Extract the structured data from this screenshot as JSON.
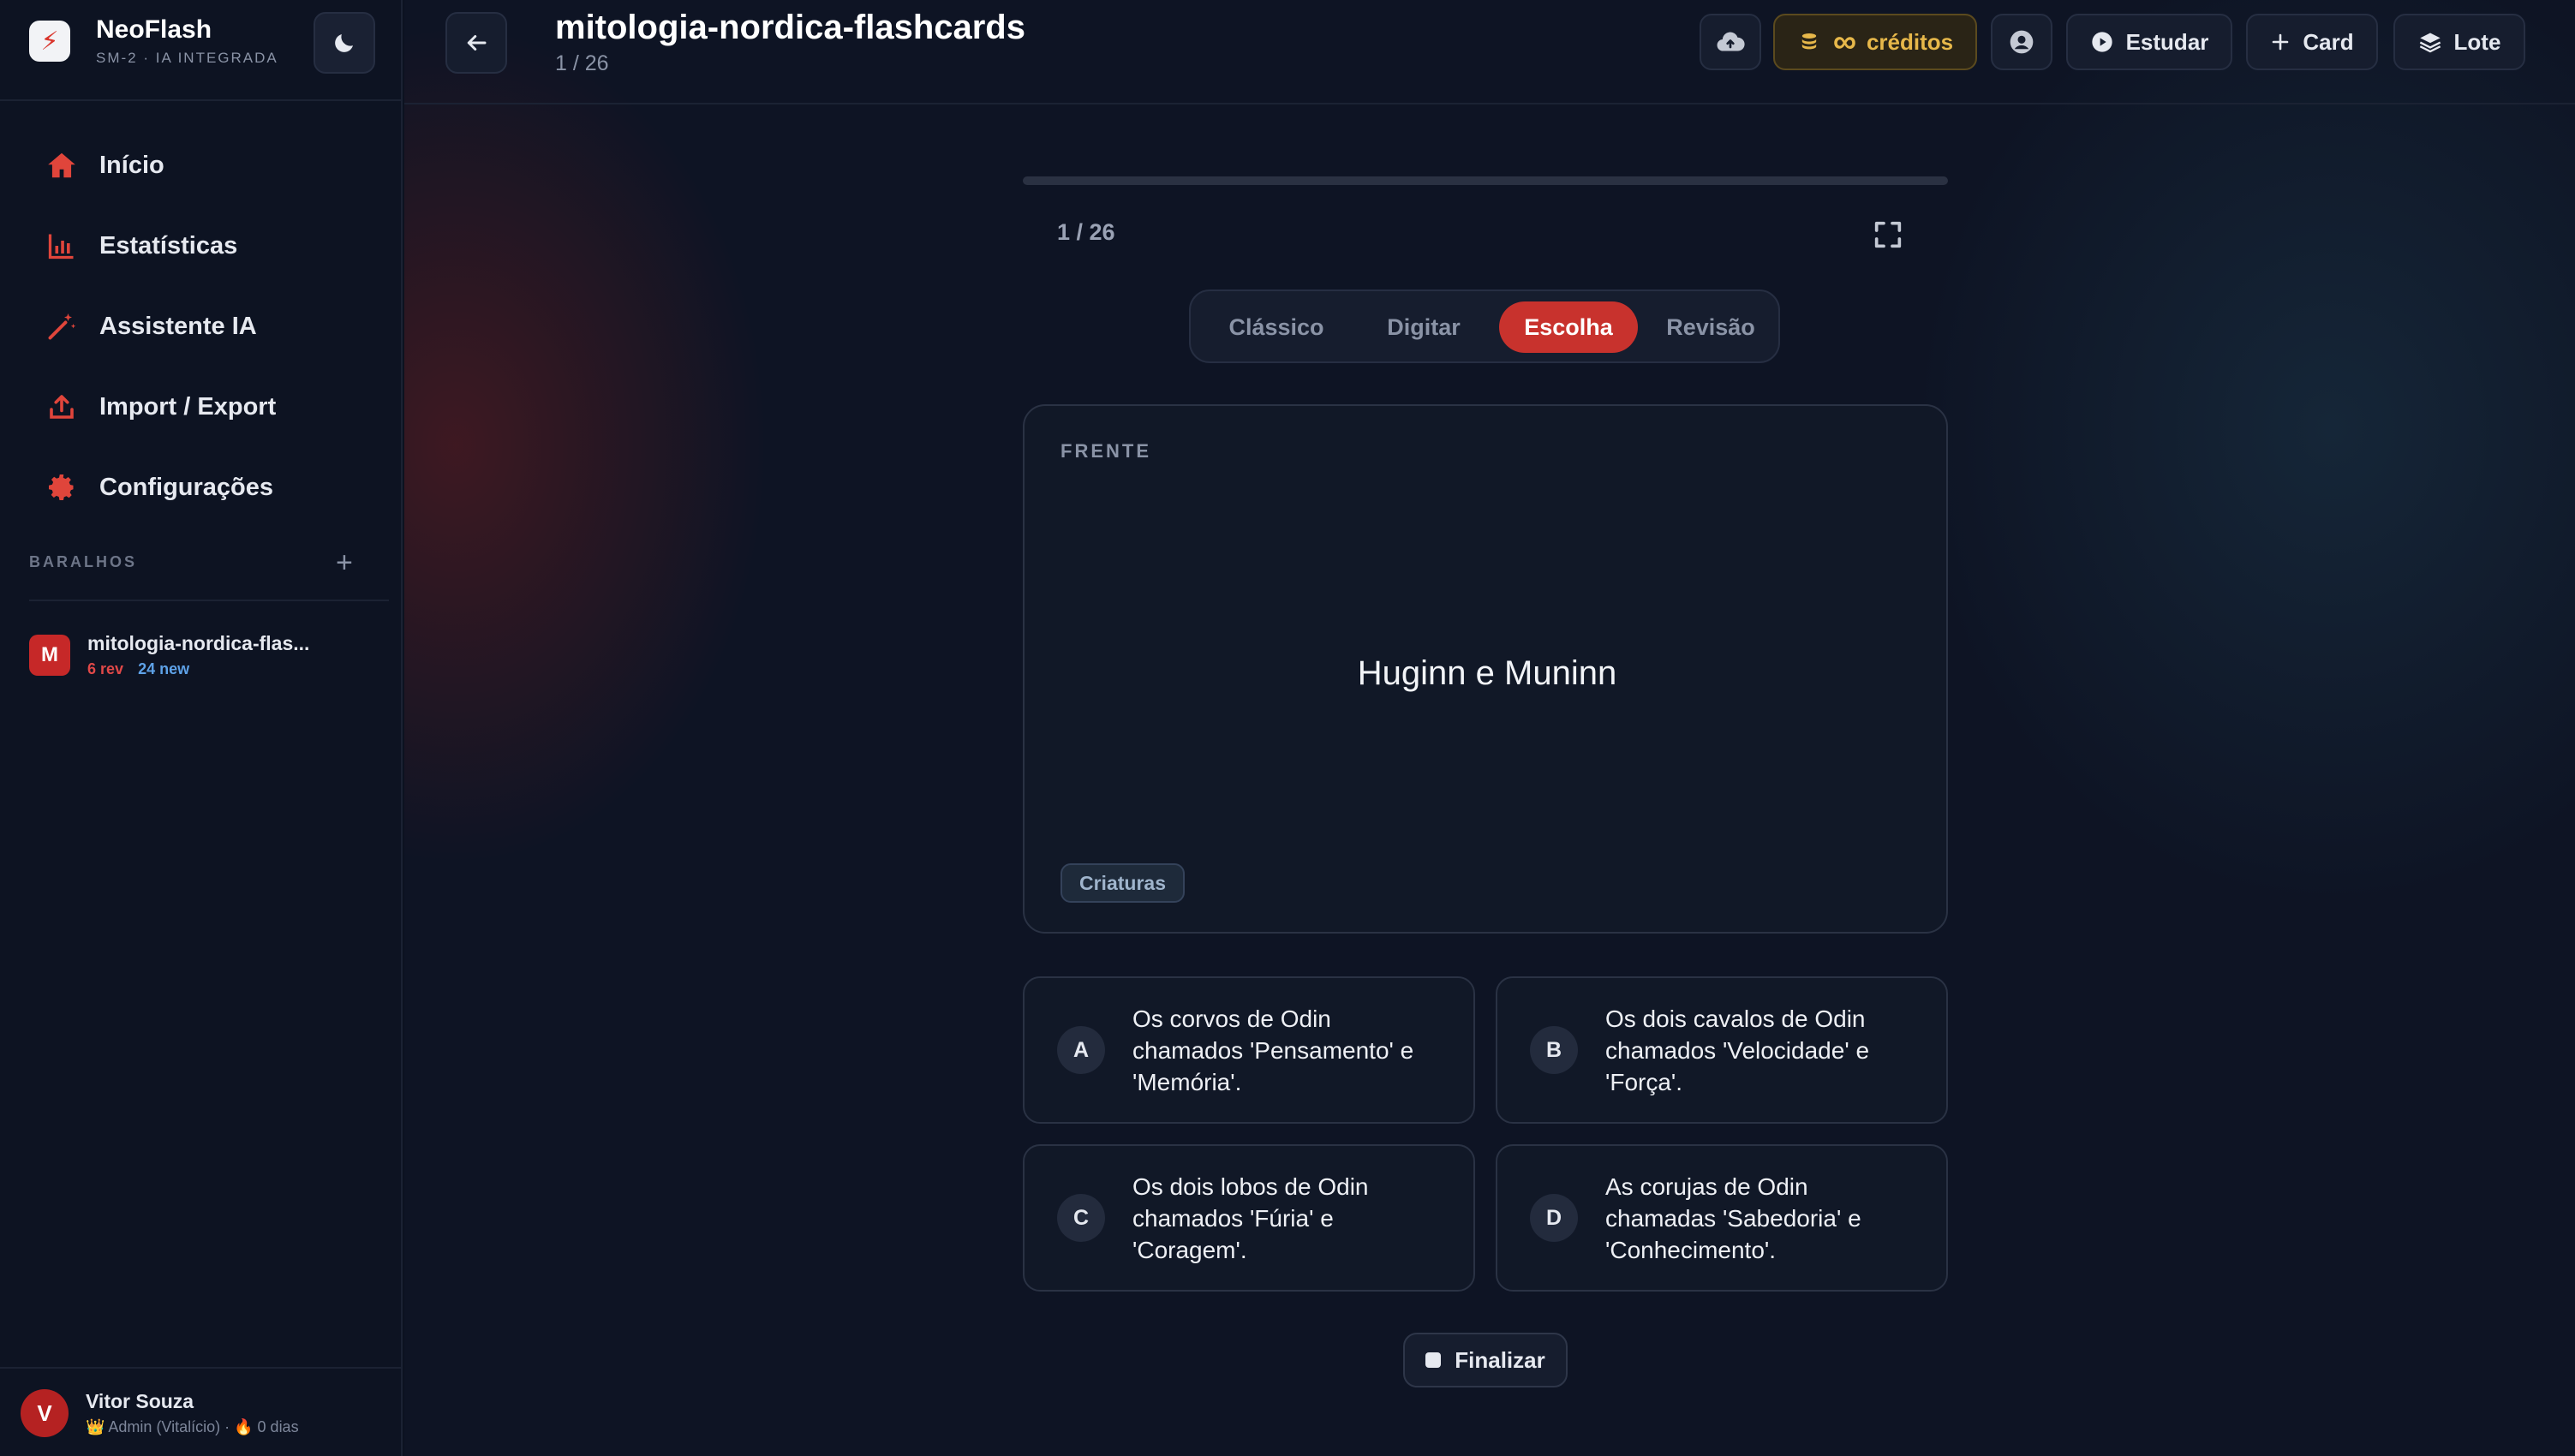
{
  "brand": {
    "name": "NeoFlash",
    "subtitle": "SM-2 · IA INTEGRADA",
    "logo_glyph": "⚡"
  },
  "sidebar": {
    "nav": [
      {
        "label": "Início",
        "icon": "home-icon"
      },
      {
        "label": "Estatísticas",
        "icon": "bar-chart-icon"
      },
      {
        "label": "Assistente IA",
        "icon": "magic-wand-icon"
      },
      {
        "label": "Import / Export",
        "icon": "upload-icon"
      },
      {
        "label": "Configurações",
        "icon": "gear-icon"
      }
    ],
    "section_label": "BARALHOS",
    "add_glyph": "+",
    "decks": [
      {
        "initial": "M",
        "name": "mitologia-nordica-flas...",
        "rev": "6 rev",
        "new": "24 new"
      }
    ],
    "user": {
      "initial": "V",
      "name": "Vitor Souza",
      "meta": "👑 Admin (Vitalício) · 🔥 0 dias"
    }
  },
  "header": {
    "title": "mitologia-nordica-flashcards",
    "subtitle": "1 / 26",
    "credits_label": "créditos",
    "infinity_glyph": "∞",
    "study_label": "Estudar",
    "card_label": "Card",
    "batch_label": "Lote"
  },
  "study": {
    "counter": "1 / 26",
    "progress": 0.0,
    "modes": [
      "Clássico",
      "Digitar",
      "Escolha",
      "Revisão"
    ],
    "active_mode": "Escolha",
    "card": {
      "side_label": "FRENTE",
      "front_text": "Huginn e Muninn",
      "tag": "Criaturas"
    },
    "options": [
      {
        "letter": "A",
        "text": "Os corvos de Odin chamados 'Pensamento' e 'Memória'."
      },
      {
        "letter": "B",
        "text": "Os dois cavalos de Odin chamados 'Velocidade' e 'Força'."
      },
      {
        "letter": "C",
        "text": "Os dois lobos de Odin chamados 'Fúria' e 'Coragem'."
      },
      {
        "letter": "D",
        "text": "As corujas de Odin chamadas 'Sabedoria' e 'Conhecimento'."
      }
    ],
    "finish_label": "Finalizar"
  },
  "colors": {
    "accent": "#c8322d",
    "credits": "#e7b84a",
    "rev": "#e04848",
    "new": "#5ea2e8"
  }
}
